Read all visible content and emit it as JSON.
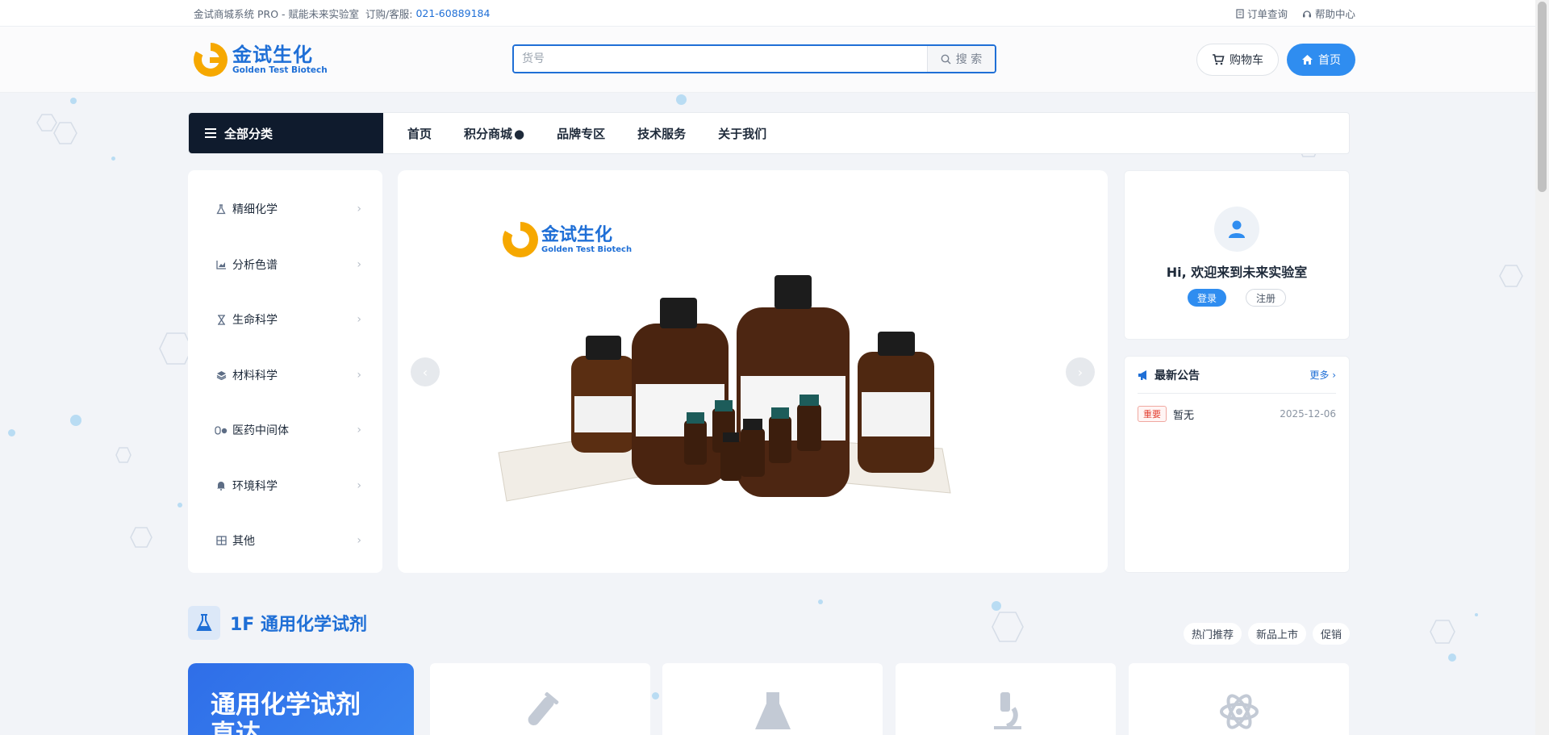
{
  "topbar": {
    "slogan": "金试商城系统 PRO - 赋能未来实验室",
    "service_label": "订购/客服:",
    "service_phone": "021-60889184",
    "order_query": "订单查询",
    "help_center": "帮助中心"
  },
  "header": {
    "logo_cn": "金试生化",
    "logo_en": "Golden Test Biotech",
    "search_placeholder": "货号",
    "search_button": "搜 索",
    "cart_button": "购物车",
    "home_button": "首页"
  },
  "nav": {
    "all_categories": "全部分类",
    "links": [
      "首页",
      "积分商城",
      "品牌专区",
      "技术服务",
      "关于我们"
    ]
  },
  "categories": [
    {
      "label": "精细化学",
      "icon": "flask-icon"
    },
    {
      "label": "分析色谱",
      "icon": "chart-icon"
    },
    {
      "label": "生命科学",
      "icon": "hourglass-icon"
    },
    {
      "label": "材料科学",
      "icon": "layers-icon"
    },
    {
      "label": "医药中间体",
      "icon": "pills-icon"
    },
    {
      "label": "环境科学",
      "icon": "bell-icon"
    },
    {
      "label": "其他",
      "icon": "grid-icon"
    }
  ],
  "banner": {
    "logo_cn": "金试生化",
    "logo_en": "Golden Test Biotech"
  },
  "user_card": {
    "greeting": "Hi, 欢迎来到未来实验室",
    "login": "登录",
    "register": "注册"
  },
  "notice": {
    "title": "最新公告",
    "more": "更多",
    "items": [
      {
        "tag": "重要",
        "text": "暂无",
        "date": "2025-12-06"
      }
    ]
  },
  "floor": {
    "title": "1F 通用化学试剂",
    "tabs": [
      "热门推荐",
      "新品上市",
      "促销"
    ],
    "promo_title": "通用化学试剂",
    "promo_subtitle": "直达",
    "product_icons": [
      "test-tube-icon",
      "flask-icon",
      "microscope-icon",
      "atom-icon"
    ]
  },
  "colors": {
    "brand_blue": "#1f6fd6",
    "accent_blue": "#2f8df0",
    "nav_dark": "#0f1b2d",
    "logo_gold": "#f6a800"
  }
}
